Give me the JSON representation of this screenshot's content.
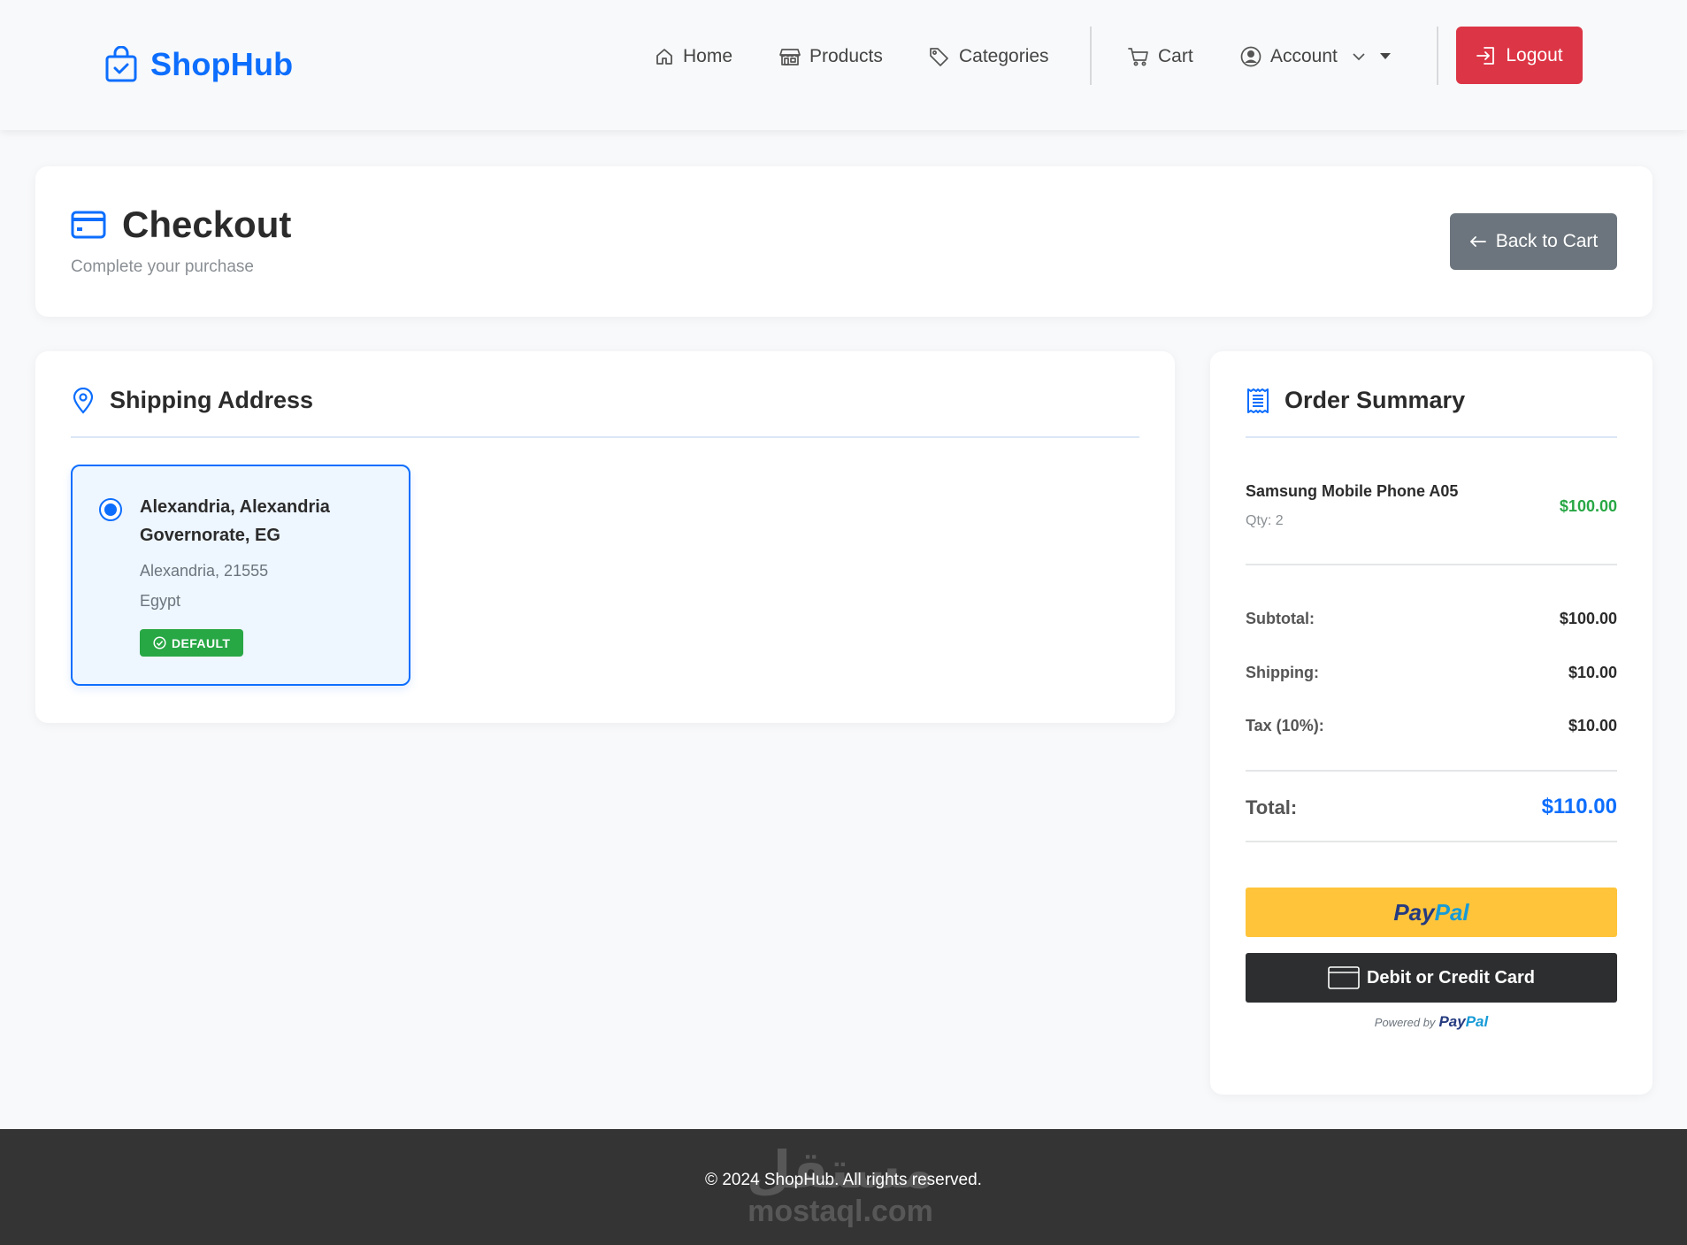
{
  "brand": {
    "name": "ShopHub",
    "icon": "shopping-bag-check-icon"
  },
  "nav": {
    "items": [
      {
        "label": "Home",
        "icon": "house-icon"
      },
      {
        "label": "Products",
        "icon": "shop-icon"
      },
      {
        "label": "Categories",
        "icon": "tags-icon"
      },
      {
        "label": "Cart",
        "icon": "cart-icon"
      },
      {
        "label": "Account",
        "icon": "person-circle-icon"
      }
    ],
    "logout_label": "Logout"
  },
  "checkout": {
    "title": "Checkout",
    "subtitle": "Complete your purchase",
    "back_label": "Back to Cart"
  },
  "shipping": {
    "heading": "Shipping Address",
    "address": {
      "title": "Alexandria, Alexandria Governorate, EG",
      "line1": "Alexandria, 21555",
      "line2": "Egypt",
      "badge": "DEFAULT",
      "selected": true
    }
  },
  "summary": {
    "heading": "Order Summary",
    "items": [
      {
        "name": "Samsung Mobile Phone A05",
        "qty": "Qty: 2",
        "price": "$100.00"
      }
    ],
    "rows": [
      {
        "label": "Subtotal:",
        "value": "$100.00"
      },
      {
        "label": "Shipping:",
        "value": "$10.00"
      },
      {
        "label": "Tax (10%):",
        "value": "$10.00"
      }
    ],
    "total_label": "Total:",
    "total_value": "$110.00",
    "paypal_part1": "Pay",
    "paypal_part2": "Pal",
    "card_button_label": "Debit or Credit Card",
    "powered_by": "Powered by",
    "powered_brand_part1": "Pay",
    "powered_brand_part2": "Pal"
  },
  "footer": {
    "copyright": "© 2024 ShopHub. All rights reserved.",
    "watermark_ar": "مستقل",
    "watermark_en": "mostaql.com"
  },
  "colors": {
    "primary": "#0d6efd",
    "danger": "#dc3545",
    "success": "#28a745",
    "secondary": "#6c757d",
    "paypal_yellow": "#ffc43a",
    "footer": "#343434"
  }
}
